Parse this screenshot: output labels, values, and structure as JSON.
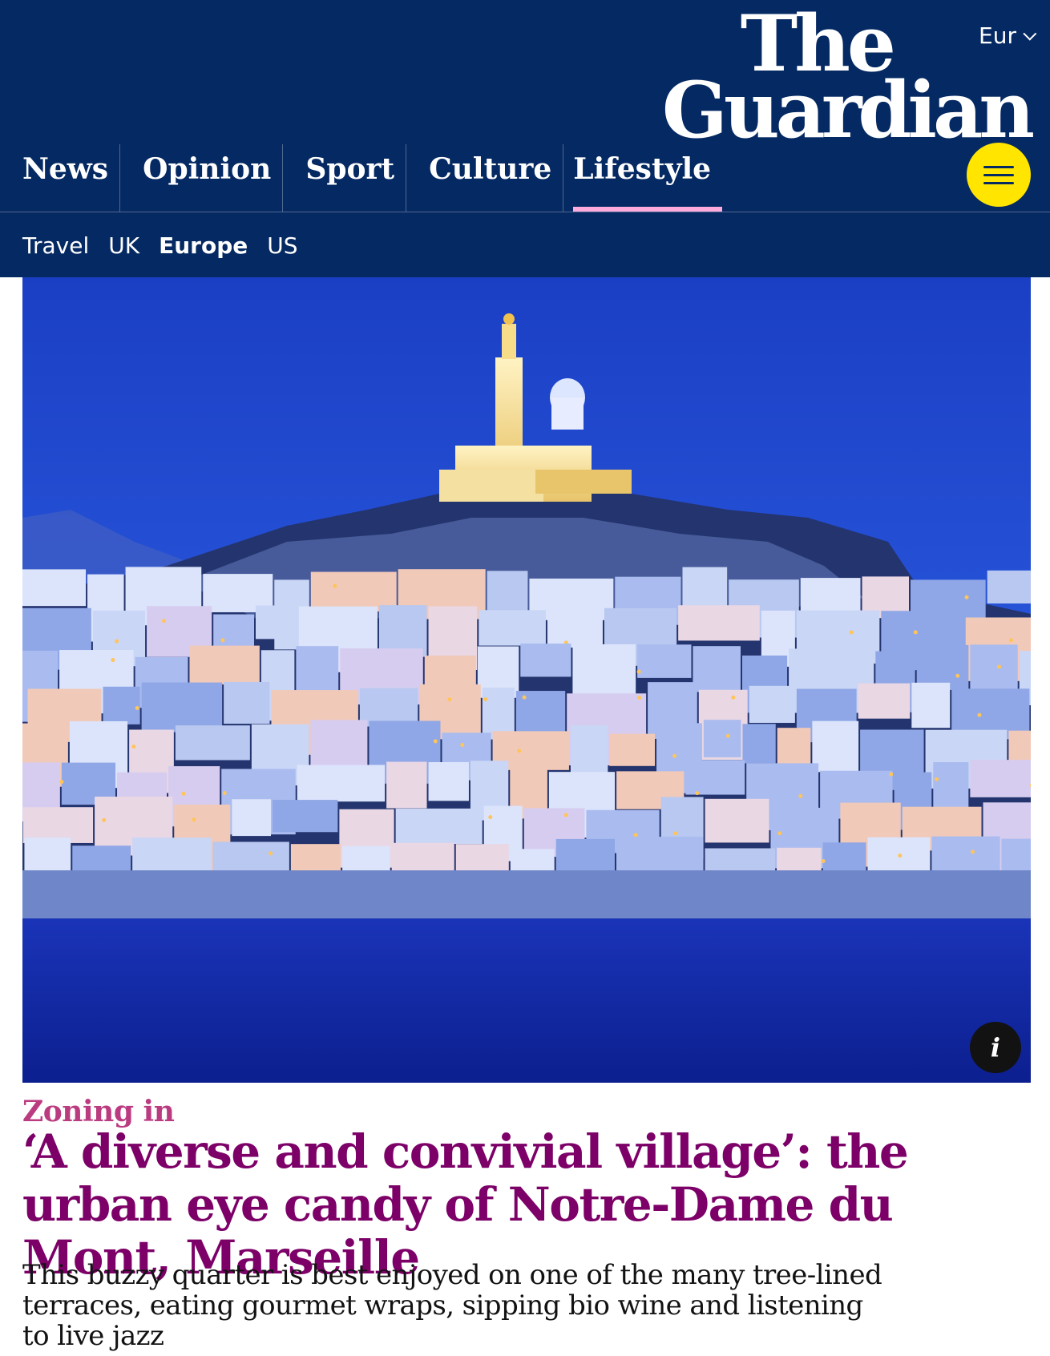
{
  "header": {
    "edition_label": "Eur",
    "logo_line1": "The",
    "logo_line2": "Guardian",
    "pillars": [
      {
        "label": "News"
      },
      {
        "label": "Opinion"
      },
      {
        "label": "Sport"
      },
      {
        "label": "Culture"
      },
      {
        "label": "Lifestyle",
        "active": true
      }
    ],
    "subnav": [
      {
        "label": "Travel"
      },
      {
        "label": "UK"
      },
      {
        "label": "Europe",
        "active": true
      },
      {
        "label": "US"
      }
    ],
    "colors": {
      "background": "#052962",
      "menu_button": "#ffe500",
      "active_underline": "#ffabdb"
    }
  },
  "hero_image": {
    "icon": "info-icon",
    "info_label": "i"
  },
  "article": {
    "kicker": "Zoning in",
    "headline": "‘A diverse and convivial village’: the urban eye candy of Notre-Dame du Mont, Marseille",
    "standfirst": "This buzzy quarter is best enjoyed on one of the many tree-lined terraces, eating gourmet wraps, sipping bio wine and listening to live jazz",
    "colors": {
      "kicker": "#bb3b80",
      "headline": "#7d0068",
      "standfirst": "#121212"
    }
  }
}
